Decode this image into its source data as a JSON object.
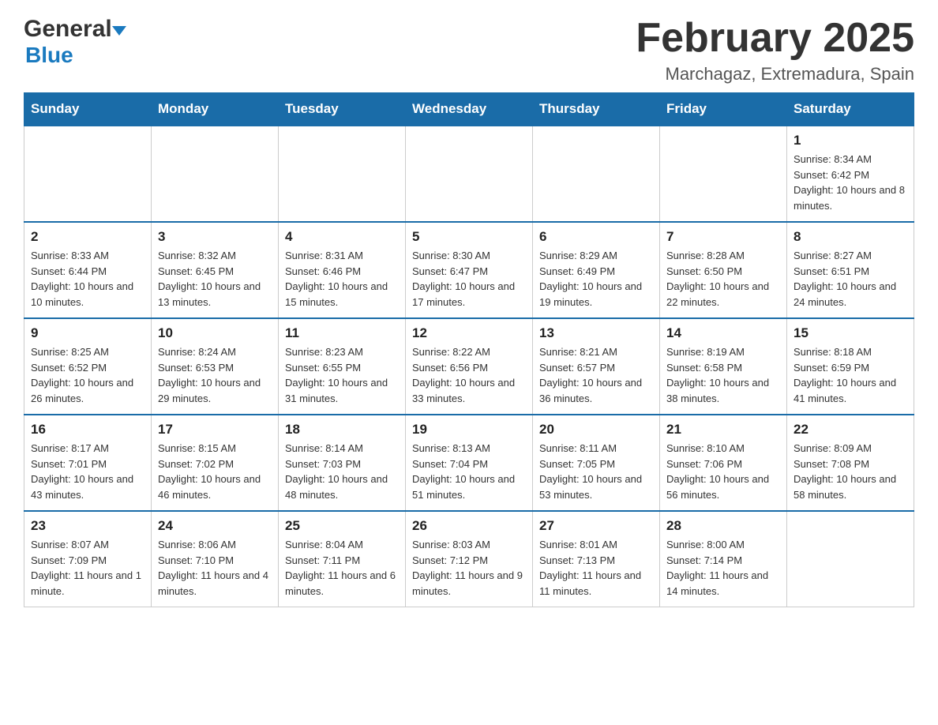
{
  "logo": {
    "general": "General",
    "blue": "Blue",
    "arrow_desc": "blue arrow"
  },
  "title": {
    "month_year": "February 2025",
    "location": "Marchagaz, Extremadura, Spain"
  },
  "weekdays": [
    "Sunday",
    "Monday",
    "Tuesday",
    "Wednesday",
    "Thursday",
    "Friday",
    "Saturday"
  ],
  "weeks": [
    [
      {
        "day": "",
        "info": ""
      },
      {
        "day": "",
        "info": ""
      },
      {
        "day": "",
        "info": ""
      },
      {
        "day": "",
        "info": ""
      },
      {
        "day": "",
        "info": ""
      },
      {
        "day": "",
        "info": ""
      },
      {
        "day": "1",
        "info": "Sunrise: 8:34 AM\nSunset: 6:42 PM\nDaylight: 10 hours and 8 minutes."
      }
    ],
    [
      {
        "day": "2",
        "info": "Sunrise: 8:33 AM\nSunset: 6:44 PM\nDaylight: 10 hours and 10 minutes."
      },
      {
        "day": "3",
        "info": "Sunrise: 8:32 AM\nSunset: 6:45 PM\nDaylight: 10 hours and 13 minutes."
      },
      {
        "day": "4",
        "info": "Sunrise: 8:31 AM\nSunset: 6:46 PM\nDaylight: 10 hours and 15 minutes."
      },
      {
        "day": "5",
        "info": "Sunrise: 8:30 AM\nSunset: 6:47 PM\nDaylight: 10 hours and 17 minutes."
      },
      {
        "day": "6",
        "info": "Sunrise: 8:29 AM\nSunset: 6:49 PM\nDaylight: 10 hours and 19 minutes."
      },
      {
        "day": "7",
        "info": "Sunrise: 8:28 AM\nSunset: 6:50 PM\nDaylight: 10 hours and 22 minutes."
      },
      {
        "day": "8",
        "info": "Sunrise: 8:27 AM\nSunset: 6:51 PM\nDaylight: 10 hours and 24 minutes."
      }
    ],
    [
      {
        "day": "9",
        "info": "Sunrise: 8:25 AM\nSunset: 6:52 PM\nDaylight: 10 hours and 26 minutes."
      },
      {
        "day": "10",
        "info": "Sunrise: 8:24 AM\nSunset: 6:53 PM\nDaylight: 10 hours and 29 minutes."
      },
      {
        "day": "11",
        "info": "Sunrise: 8:23 AM\nSunset: 6:55 PM\nDaylight: 10 hours and 31 minutes."
      },
      {
        "day": "12",
        "info": "Sunrise: 8:22 AM\nSunset: 6:56 PM\nDaylight: 10 hours and 33 minutes."
      },
      {
        "day": "13",
        "info": "Sunrise: 8:21 AM\nSunset: 6:57 PM\nDaylight: 10 hours and 36 minutes."
      },
      {
        "day": "14",
        "info": "Sunrise: 8:19 AM\nSunset: 6:58 PM\nDaylight: 10 hours and 38 minutes."
      },
      {
        "day": "15",
        "info": "Sunrise: 8:18 AM\nSunset: 6:59 PM\nDaylight: 10 hours and 41 minutes."
      }
    ],
    [
      {
        "day": "16",
        "info": "Sunrise: 8:17 AM\nSunset: 7:01 PM\nDaylight: 10 hours and 43 minutes."
      },
      {
        "day": "17",
        "info": "Sunrise: 8:15 AM\nSunset: 7:02 PM\nDaylight: 10 hours and 46 minutes."
      },
      {
        "day": "18",
        "info": "Sunrise: 8:14 AM\nSunset: 7:03 PM\nDaylight: 10 hours and 48 minutes."
      },
      {
        "day": "19",
        "info": "Sunrise: 8:13 AM\nSunset: 7:04 PM\nDaylight: 10 hours and 51 minutes."
      },
      {
        "day": "20",
        "info": "Sunrise: 8:11 AM\nSunset: 7:05 PM\nDaylight: 10 hours and 53 minutes."
      },
      {
        "day": "21",
        "info": "Sunrise: 8:10 AM\nSunset: 7:06 PM\nDaylight: 10 hours and 56 minutes."
      },
      {
        "day": "22",
        "info": "Sunrise: 8:09 AM\nSunset: 7:08 PM\nDaylight: 10 hours and 58 minutes."
      }
    ],
    [
      {
        "day": "23",
        "info": "Sunrise: 8:07 AM\nSunset: 7:09 PM\nDaylight: 11 hours and 1 minute."
      },
      {
        "day": "24",
        "info": "Sunrise: 8:06 AM\nSunset: 7:10 PM\nDaylight: 11 hours and 4 minutes."
      },
      {
        "day": "25",
        "info": "Sunrise: 8:04 AM\nSunset: 7:11 PM\nDaylight: 11 hours and 6 minutes."
      },
      {
        "day": "26",
        "info": "Sunrise: 8:03 AM\nSunset: 7:12 PM\nDaylight: 11 hours and 9 minutes."
      },
      {
        "day": "27",
        "info": "Sunrise: 8:01 AM\nSunset: 7:13 PM\nDaylight: 11 hours and 11 minutes."
      },
      {
        "day": "28",
        "info": "Sunrise: 8:00 AM\nSunset: 7:14 PM\nDaylight: 11 hours and 14 minutes."
      },
      {
        "day": "",
        "info": ""
      }
    ]
  ]
}
